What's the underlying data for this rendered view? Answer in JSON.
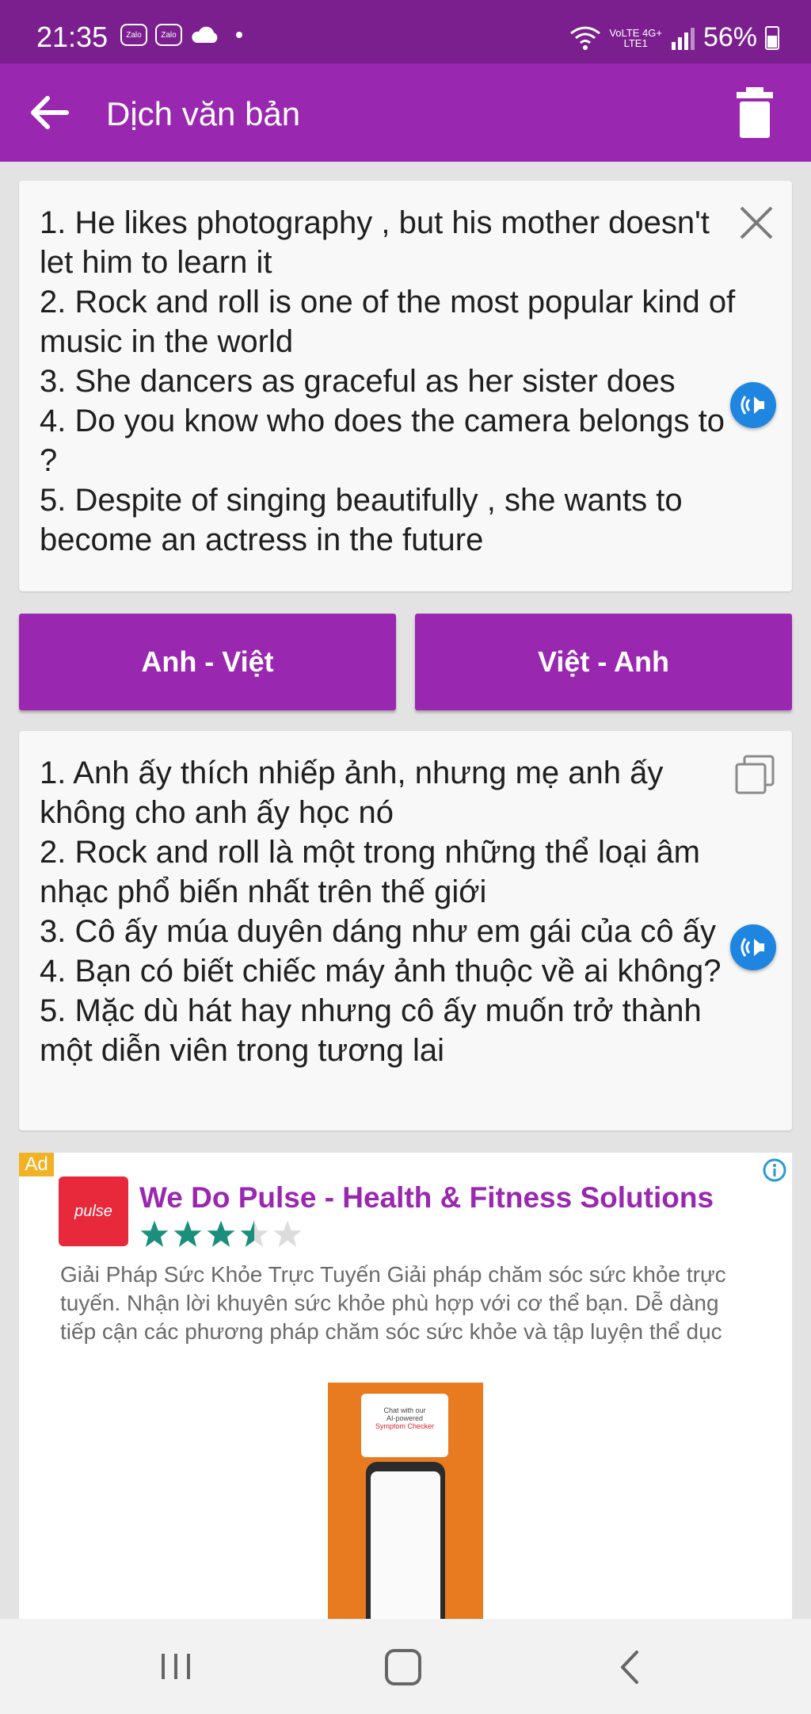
{
  "status": {
    "time": "21:35",
    "notif_icons": [
      "zalo-icon",
      "zalo-icon",
      "cloud-icon"
    ],
    "zalo_label": "Zalo",
    "network_top": "VoLTE 4G+",
    "network_bottom": "LTE1",
    "battery": "56%"
  },
  "appbar": {
    "title": "Dịch văn bản",
    "color": "#9a27b0"
  },
  "source": {
    "text": "1. He likes photography , but his mother doesn't let him to learn it\n2. Rock and roll is one of the most popular kind of music in the world\n3. She dancers as graceful as her sister does\n4. Do you know who does the camera belongs to ?\n5. Despite of singing beautifully , she wants to become an actress in the future"
  },
  "buttons": {
    "en_vi": "Anh - Việt",
    "vi_en": "Việt - Anh"
  },
  "result": {
    "text": "1. Anh ấy thích nhiếp ảnh, nhưng mẹ anh ấy không cho anh ấy học nó\n2. Rock and roll là một trong những thể loại âm nhạc phổ biến nhất trên thế giới\n3. Cô ấy múa duyên dáng như em gái của cô ấy 4. Bạn có biết chiếc máy ảnh thuộc về ai không?\n5. Mặc dù hát hay nhưng cô ấy muốn trở thành một diễn viên trong tương lai"
  },
  "ad": {
    "badge": "Ad",
    "logo_text": "pulse",
    "title": "We Do Pulse - Health & Fitness Solutions",
    "rating": 3.5,
    "rating_max": 5,
    "description": "Giải Pháp Sức Khỏe Trực Tuyến Giải pháp chăm sóc sức khỏe trực tuyến. Nhận lời khuyên sức khỏe phù hợp với cơ thể bạn. Dễ dàng tiếp cận các phương pháp chăm sóc sức khỏe và tập luyện thể dục",
    "image_bubble_line1": "Chat with our",
    "image_bubble_line2": "AI-powered",
    "image_bubble_line3": "Symptom Checker"
  }
}
